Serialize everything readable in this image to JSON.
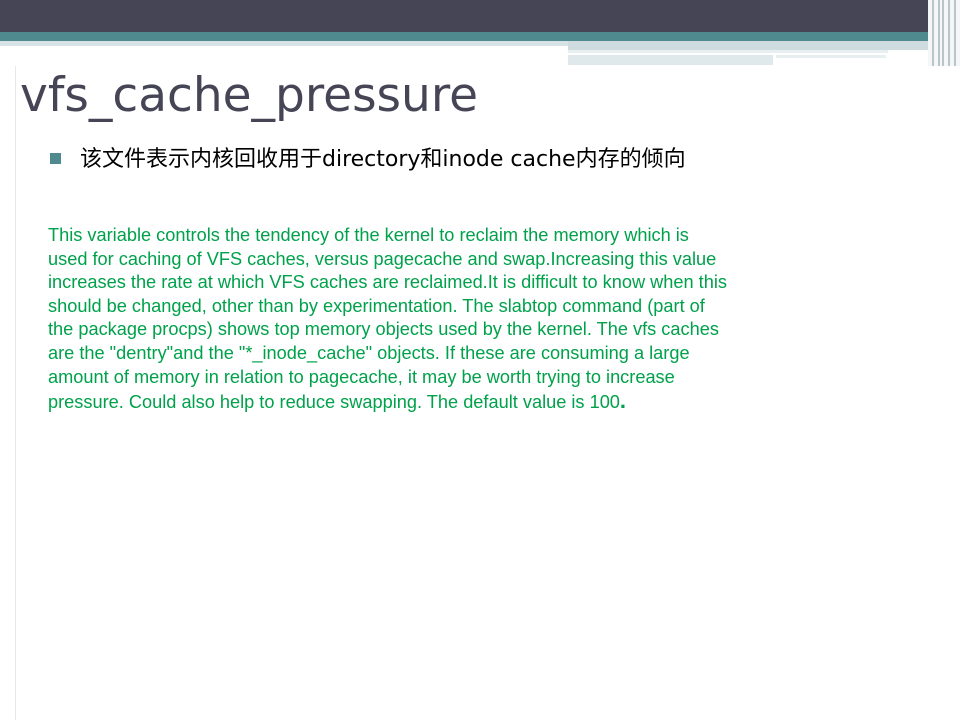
{
  "slide": {
    "title": "vfs_cache_pressure",
    "bullet": "该文件表示内核回收用于directory和inode cache内存的倾向",
    "body_lines": [
      "This variable controls the tendency of the kernel to reclaim the memory which is",
      "used for caching of VFS caches, versus pagecache and swap.Increasing this value",
      "increases the rate at which VFS caches are reclaimed.It is difficult to know when this",
      "should be changed, other than by experimentation. The slabtop command (part of",
      "the package procps) shows top memory objects used by the kernel. The vfs caches",
      "are the \"dentry\"and the \"*_inode_cache\" objects. If these are consuming a large",
      "amount of memory in relation to pagecache, it may be worth trying to increase",
      "pressure. Could also help to reduce swapping. The default value is 100"
    ],
    "body_end": "."
  },
  "colors": {
    "title": "#454556",
    "accent": "#4f8a8e",
    "body": "#00a14b"
  }
}
